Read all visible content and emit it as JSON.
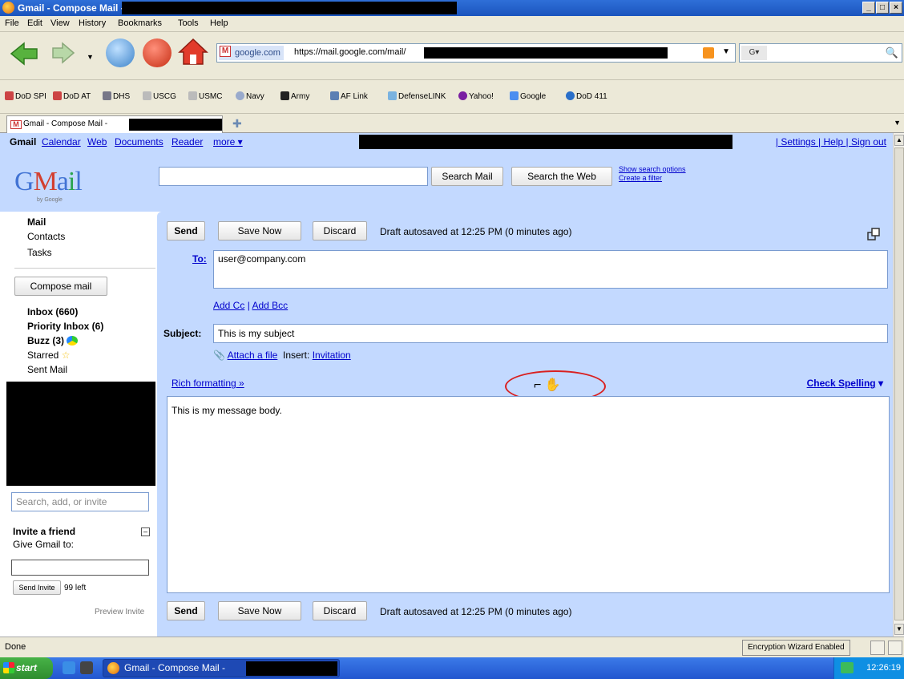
{
  "window": {
    "title": "Gmail - Compose Mail -",
    "controls": [
      "_",
      "□",
      "×"
    ]
  },
  "menu": [
    "File",
    "Edit",
    "View",
    "History",
    "Bookmarks",
    "Tools",
    "Help"
  ],
  "urlbar": {
    "site_identity": "google.com",
    "url": "https://mail.google.com/mail/"
  },
  "bookmarks": [
    "DoD SPI",
    "DoD AT",
    "DHS",
    "USCG",
    "USMC",
    "Navy",
    "Army",
    "AF Link",
    "DefenseLINK",
    "Yahoo!",
    "Google",
    "DoD 411"
  ],
  "tab": {
    "title": "Gmail - Compose Mail -"
  },
  "topnav": {
    "brand": "Gmail",
    "links": [
      "Calendar",
      "Web",
      "Documents",
      "Reader",
      "more ▾"
    ],
    "right": "| Settings | Help | Sign out"
  },
  "header": {
    "logo": "Gmail",
    "logo_sub": "by Google",
    "search_mail": "Search Mail",
    "search_web": "Search the Web",
    "show_search_options": "Show search options",
    "create_filter": "Create a filter"
  },
  "leftnav": {
    "mail": "Mail",
    "contacts": "Contacts",
    "tasks": "Tasks",
    "compose": "Compose mail",
    "inbox": "Inbox (660)",
    "priority_inbox": "Priority Inbox (6)",
    "buzz": "Buzz (3)",
    "starred": "Starred",
    "sent": "Sent Mail",
    "search_placeholder": "Search, add, or invite",
    "invite_title": "Invite a friend",
    "invite_sub": "Give Gmail to:",
    "send_invite": "Send Invite",
    "invites_left": "99 left",
    "preview_invite": "Preview Invite"
  },
  "compose": {
    "send": "Send",
    "save_now": "Save Now",
    "discard": "Discard",
    "autosave_status": "Draft autosaved at 12:25 PM (0 minutes ago)",
    "to_label": "To:",
    "to_value": "user@company.com",
    "add_cc": "Add Cc",
    "add_bcc": "Add Bcc",
    "subject_label": "Subject:",
    "subject_value": "This is my subject",
    "attach": "Attach a file",
    "insert_label": "Insert:",
    "invitation": "Invitation",
    "rich_formatting": "Rich formatting »",
    "check_spelling": "Check Spelling",
    "body": "This is my message body."
  },
  "status": {
    "text": "Done",
    "encryption": "Encryption Wizard Enabled"
  },
  "taskbar": {
    "start": "start",
    "task": "Gmail - Compose Mail -",
    "clock": "12:26:19"
  }
}
